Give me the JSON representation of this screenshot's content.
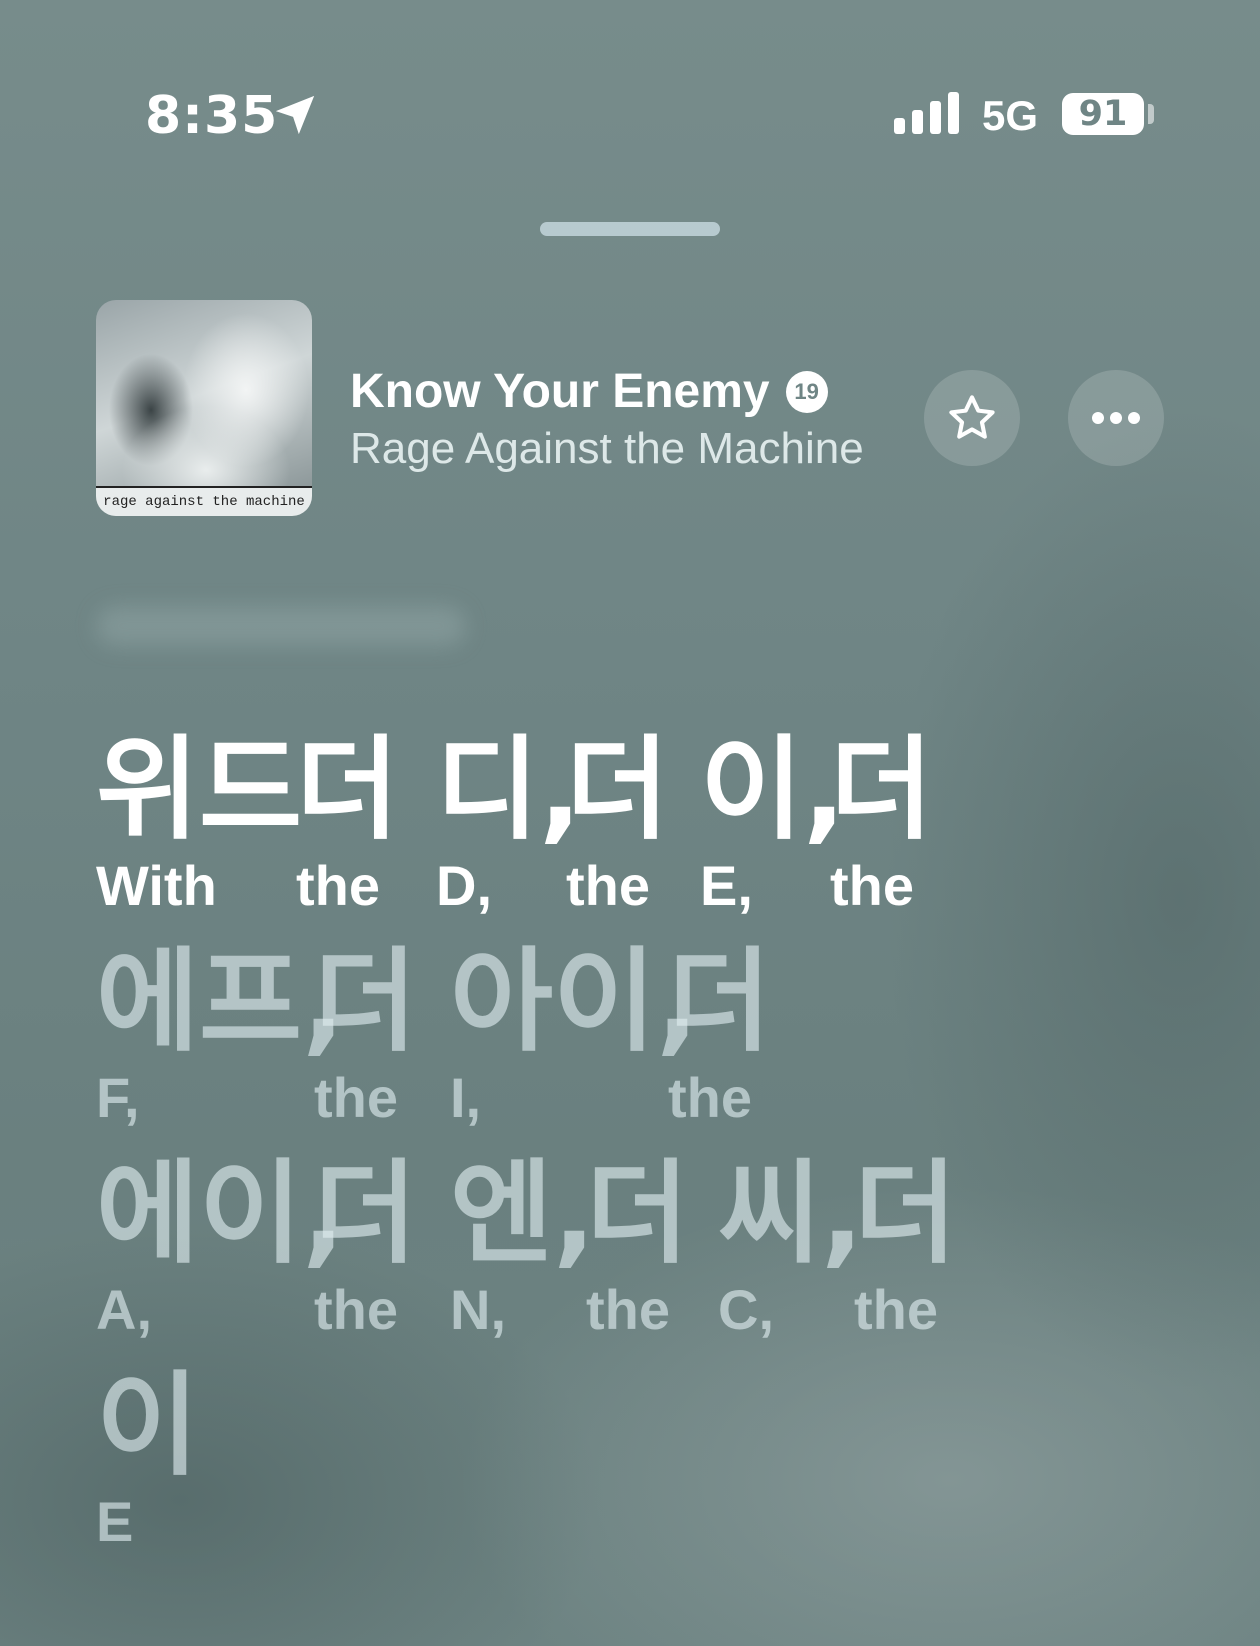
{
  "status_bar": {
    "time": "8:35",
    "network": "5G",
    "battery": "91",
    "icons": [
      "location-arrow-icon",
      "cellular-signal-icon",
      "battery-icon"
    ]
  },
  "now_playing": {
    "title": "Know Your Enemy",
    "explicit_badge": "19",
    "artist": "Rage Against the Machine",
    "album_art_text": "rage against the machine",
    "buttons": [
      "star-icon",
      "more-icon"
    ]
  },
  "lyrics": [
    {
      "state": "active",
      "pairs": [
        {
          "korean": "위드",
          "roman": "With"
        },
        {
          "korean": "더",
          "roman": "the"
        },
        {
          "korean": "디,",
          "roman": "D,"
        },
        {
          "korean": "더",
          "roman": "the"
        },
        {
          "korean": "이,",
          "roman": "E,"
        },
        {
          "korean": "더",
          "roman": "the"
        }
      ]
    },
    {
      "state": "upcoming",
      "pairs": [
        {
          "korean": "에프,",
          "roman": "F,"
        },
        {
          "korean": "더",
          "roman": "the"
        },
        {
          "korean": "아이,",
          "roman": "I,"
        },
        {
          "korean": "더",
          "roman": "the"
        }
      ]
    },
    {
      "state": "upcoming",
      "pairs": [
        {
          "korean": "에이,",
          "roman": "A,"
        },
        {
          "korean": "더",
          "roman": "the"
        },
        {
          "korean": "엔,",
          "roman": "N,"
        },
        {
          "korean": "더",
          "roman": "the"
        },
        {
          "korean": "씨,",
          "roman": "C,"
        },
        {
          "korean": "더",
          "roman": "the"
        }
      ]
    },
    {
      "state": "upcoming",
      "pairs": [
        {
          "korean": "이",
          "roman": "E"
        }
      ]
    }
  ]
}
